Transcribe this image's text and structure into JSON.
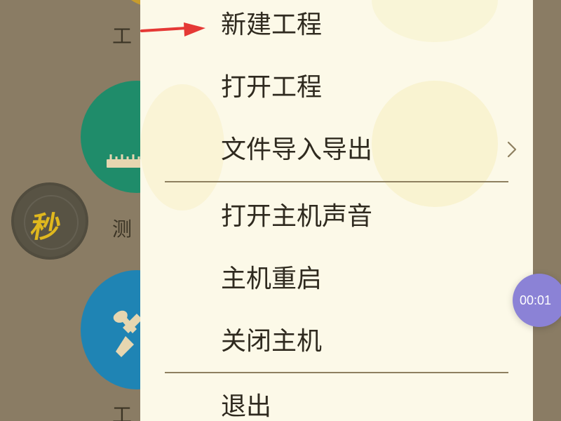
{
  "background": {
    "labels": {
      "top": "工",
      "middle": "测",
      "bottom": "工"
    },
    "dark_icon_glyph": "秒",
    "colors": {
      "background": "#8a7c64",
      "yellow_icon": "#c89c2d",
      "green_icon": "#1f8c6a",
      "blue_icon": "#1f84b4",
      "dark_icon": "#585344"
    },
    "icons": {
      "top": "app-icon",
      "green": "ruler-icon",
      "blue": "wrench-screwdriver-icon",
      "dark": "timer-icon"
    }
  },
  "menu": {
    "items": [
      {
        "label": "新建工程"
      },
      {
        "label": "打开工程"
      },
      {
        "label": "文件导入导出",
        "has_submenu": true,
        "submenu_icon": "chevron-right-icon"
      },
      {
        "label": "打开主机声音"
      },
      {
        "label": "主机重启"
      },
      {
        "label": "关闭主机"
      },
      {
        "label": "退出"
      }
    ],
    "colors": {
      "panel": "#fcf9e8",
      "text": "#2f2a1f",
      "divider": "#8e8060"
    }
  },
  "annotation": {
    "arrow_color": "#e53935",
    "arrow_icon": "arrow-right-icon"
  },
  "overlay": {
    "timer": "00:01",
    "timer_color": "#8b82d6"
  }
}
